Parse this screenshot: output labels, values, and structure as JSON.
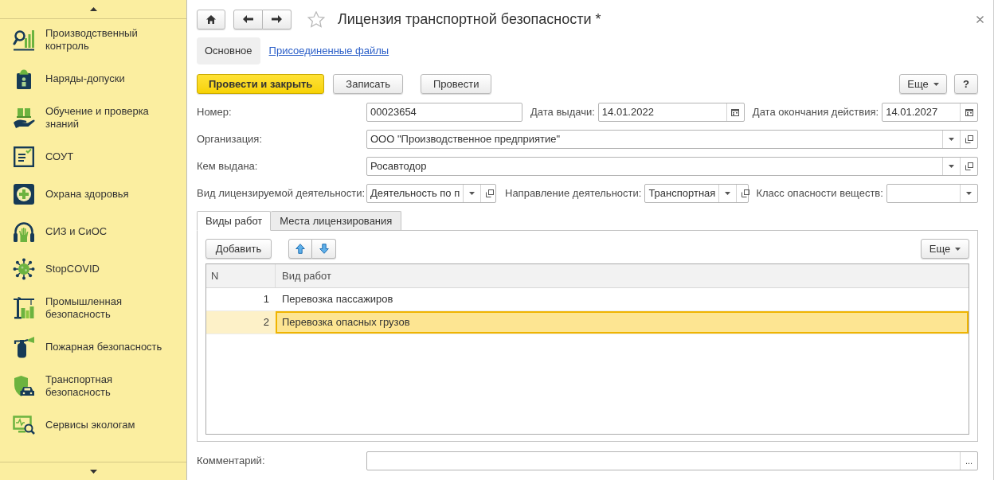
{
  "sidebar": {
    "items": [
      {
        "label": "Производственный контроль"
      },
      {
        "label": "Наряды-допуски"
      },
      {
        "label": "Обучение и проверка знаний"
      },
      {
        "label": "СОУТ"
      },
      {
        "label": "Охрана здоровья"
      },
      {
        "label": "СИЗ и СиОС"
      },
      {
        "label": "StopCOVID"
      },
      {
        "label": "Промышленная безопасность"
      },
      {
        "label": "Пожарная безопасность"
      },
      {
        "label": "Транспортная безопасность"
      },
      {
        "label": "Сервисы экологам"
      }
    ]
  },
  "window": {
    "title": "Лицензия транспортной безопасности *",
    "starred": false
  },
  "form_tabs": [
    {
      "label": "Основное",
      "selected": true
    },
    {
      "label": "Присоединенные файлы",
      "selected": false
    }
  ],
  "toolbar": {
    "buttons": [
      {
        "label": "Провести и закрыть",
        "default": true
      },
      {
        "label": "Записать",
        "default": false
      },
      {
        "label": "Провести",
        "default": false
      }
    ],
    "more": "Еще",
    "help": "?"
  },
  "field_rows": [
    {
      "fields": [
        {
          "kind": "text",
          "label": "Номер:",
          "value": "00023654"
        },
        {
          "kind": "date",
          "label": "Дата выдачи:",
          "value": "14.01.2022"
        },
        {
          "kind": "date",
          "label": "Дата окончания действия:",
          "value": "14.01.2027"
        }
      ]
    },
    {
      "fields": [
        {
          "kind": "reference",
          "label": "Организация:",
          "value": "ООО \"Производственное предприятие\""
        }
      ]
    },
    {
      "fields": [
        {
          "kind": "reference",
          "label": "Кем выдана:",
          "value": "Росавтодор"
        }
      ]
    },
    {
      "fields": [
        {
          "kind": "reference",
          "label": "Вид лицензируемой деятельности:",
          "value": "Деятельность по п"
        },
        {
          "kind": "reference",
          "label": "Направление деятельности:",
          "value": "Транспортная"
        },
        {
          "kind": "select",
          "label": "Класс опасности веществ:"
        }
      ]
    }
  ],
  "tabs": [
    {
      "label": "Виды работ",
      "selected": true
    },
    {
      "label": "Места лицензирования",
      "selected": false
    }
  ],
  "table_toolbar": {
    "add": "Добавить",
    "more": "Еще"
  },
  "table": {
    "columns": [
      "N",
      "Вид работ"
    ],
    "rows": [
      {
        "n": "1",
        "work_type": "Перевозка пассажиров",
        "selected": false
      },
      {
        "n": "2",
        "work_type": "Перевозка опасных грузов",
        "selected": true
      }
    ]
  },
  "comment": {
    "label": "Комментарий:",
    "button": "..."
  }
}
